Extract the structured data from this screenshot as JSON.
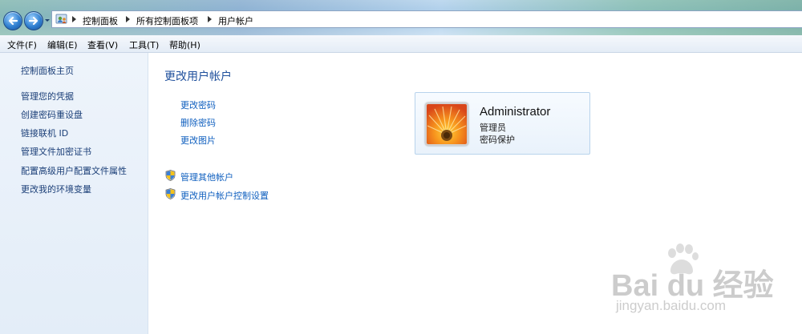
{
  "address_bar": {
    "crumbs": [
      "控制面板",
      "所有控制面板项",
      "用户帐户"
    ]
  },
  "menu": {
    "items": [
      "文件(F)",
      "编辑(E)",
      "查看(V)",
      "工具(T)",
      "帮助(H)"
    ]
  },
  "sidebar": {
    "items": [
      {
        "label": "控制面板主页"
      },
      {
        "label": "管理您的凭据"
      },
      {
        "label": "创建密码重设盘"
      },
      {
        "label": "链接联机 ID"
      },
      {
        "label": "管理文件加密证书"
      },
      {
        "label": "配置高级用户配置文件属性"
      },
      {
        "label": "更改我的环境变量"
      }
    ]
  },
  "main": {
    "title": "更改用户帐户",
    "tasks": [
      "更改密码",
      "删除密码",
      "更改图片"
    ],
    "admin_tasks": [
      "管理其他帐户",
      "更改用户帐户控制设置"
    ]
  },
  "account": {
    "name": "Administrator",
    "role": "管理员",
    "status": "密码保护"
  },
  "watermark": {
    "brand": "Bai du 经验",
    "url": "jingyan.baidu.com"
  },
  "colors": {
    "link": "#0f5fbf",
    "title": "#1e4f9c",
    "sidebar_bg": "#e8f0f9"
  }
}
